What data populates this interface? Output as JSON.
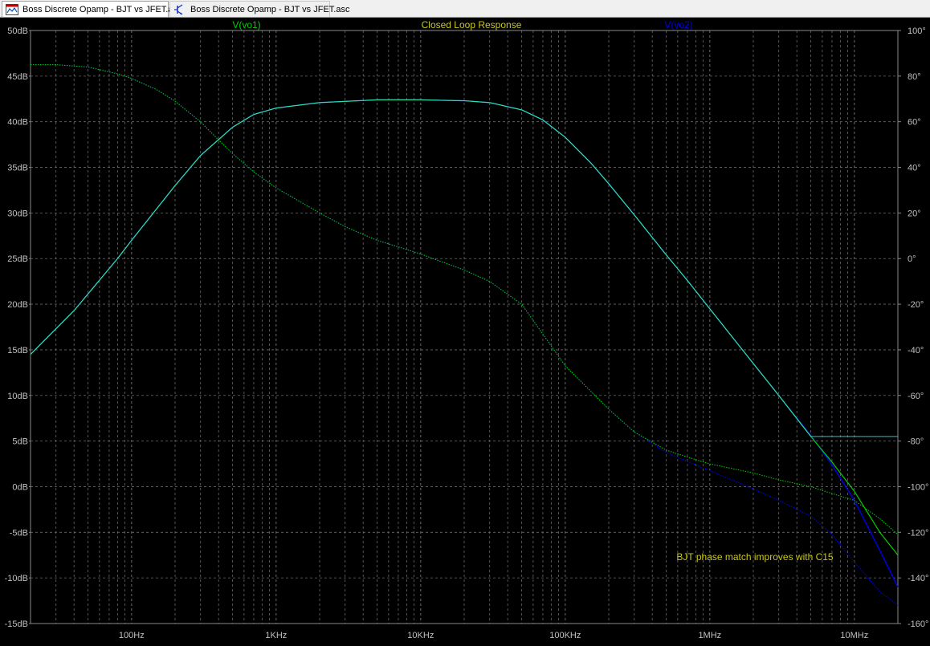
{
  "tabs": [
    {
      "label": "Boss Discrete Opamp - BJT vs JFET.asc",
      "icon": "waveform-window-icon",
      "active": true
    },
    {
      "label": "Boss Discrete Opamp - BJT vs JFET.asc",
      "icon": "schematic-transistor-icon",
      "active": false
    }
  ],
  "colors": {
    "background": "#000000",
    "grid": "#6a6a6a",
    "axis_text": "#c0c0c0",
    "title": "#c8c820",
    "vo1": "#00d000",
    "vo2": "#0000e0",
    "overlap": "#40e0e0",
    "annotation": "#c8c820"
  },
  "chart_data": {
    "type": "line",
    "title": "Closed Loop Response",
    "annotation": "BJT phase match improves with C15",
    "x_scale": "log",
    "xlim": [
      20,
      20000000
    ],
    "x_ticks": [
      {
        "value": 100,
        "label": "100Hz"
      },
      {
        "value": 1000,
        "label": "1KHz"
      },
      {
        "value": 10000,
        "label": "10KHz"
      },
      {
        "value": 100000,
        "label": "100KHz"
      },
      {
        "value": 1000000,
        "label": "1MHz"
      },
      {
        "value": 10000000,
        "label": "10MHz"
      }
    ],
    "y_left": {
      "unit": "dB",
      "lim": [
        -15,
        50
      ],
      "ticks": [
        "50dB",
        "45dB",
        "40dB",
        "35dB",
        "30dB",
        "25dB",
        "20dB",
        "15dB",
        "10dB",
        "5dB",
        "0dB",
        "-5dB",
        "-10dB",
        "-15dB"
      ]
    },
    "y_right": {
      "unit": "°",
      "lim": [
        -160,
        100
      ],
      "ticks": [
        "100°",
        "80°",
        "60°",
        "40°",
        "20°",
        "0°",
        "-20°",
        "-40°",
        "-60°",
        "-80°",
        "-100°",
        "-120°",
        "-140°",
        "-160°"
      ]
    },
    "grid": true,
    "series": [
      {
        "name": "V(vo1)",
        "magnitude_db": [
          [
            20,
            14.5
          ],
          [
            40,
            19.3
          ],
          [
            80,
            25
          ],
          [
            100,
            27
          ],
          [
            200,
            33
          ],
          [
            300,
            36.3
          ],
          [
            500,
            39.4
          ],
          [
            700,
            40.8
          ],
          [
            1000,
            41.5
          ],
          [
            2000,
            42.1
          ],
          [
            5000,
            42.4
          ],
          [
            10000,
            42.4
          ],
          [
            20000,
            42.3
          ],
          [
            30000,
            42.1
          ],
          [
            50000,
            41.3
          ],
          [
            70000,
            40.2
          ],
          [
            100000,
            38.3
          ],
          [
            150000,
            35.5
          ],
          [
            200000,
            33.2
          ],
          [
            300000,
            29.8
          ],
          [
            500000,
            25.4
          ],
          [
            700000,
            22.6
          ],
          [
            1000000,
            19.5
          ],
          [
            2000000,
            13.5
          ],
          [
            3000000,
            10
          ],
          [
            5000000,
            5.5
          ],
          [
            7000000,
            2.7
          ],
          [
            10000000,
            -0.5
          ],
          [
            15000000,
            -5
          ],
          [
            20000000,
            -7.5
          ]
        ],
        "phase_deg": [
          [
            20,
            85
          ],
          [
            30,
            85
          ],
          [
            50,
            84
          ],
          [
            80,
            81
          ],
          [
            100,
            79
          ],
          [
            150,
            74
          ],
          [
            200,
            69
          ],
          [
            300,
            60
          ],
          [
            400,
            52
          ],
          [
            500,
            46
          ],
          [
            700,
            38
          ],
          [
            1000,
            31
          ],
          [
            2000,
            20
          ],
          [
            3000,
            14
          ],
          [
            5000,
            8
          ],
          [
            8000,
            4
          ],
          [
            10000,
            2
          ],
          [
            20000,
            -5
          ],
          [
            30000,
            -10
          ],
          [
            50000,
            -20
          ],
          [
            100000,
            -47
          ],
          [
            200000,
            -66
          ],
          [
            300000,
            -76
          ],
          [
            500000,
            -84
          ],
          [
            700000,
            -87
          ],
          [
            1000000,
            -90
          ],
          [
            2000000,
            -94
          ],
          [
            3000000,
            -97
          ],
          [
            5000000,
            -100
          ],
          [
            7000000,
            -103
          ],
          [
            10000000,
            -106
          ],
          [
            15000000,
            -114
          ],
          [
            20000000,
            -121
          ]
        ]
      },
      {
        "name": "V(vo2)",
        "magnitude_db": [
          [
            20,
            14.5
          ],
          [
            40,
            19.3
          ],
          [
            80,
            25
          ],
          [
            100,
            27
          ],
          [
            200,
            33
          ],
          [
            300,
            36.3
          ],
          [
            500,
            39.4
          ],
          [
            700,
            40.8
          ],
          [
            1000,
            41.5
          ],
          [
            2000,
            42.1
          ],
          [
            5000,
            42.4
          ],
          [
            10000,
            42.4
          ],
          [
            20000,
            42.3
          ],
          [
            30000,
            42.1
          ],
          [
            50000,
            41.3
          ],
          [
            70000,
            40.2
          ],
          [
            100000,
            38.3
          ],
          [
            150000,
            35.5
          ],
          [
            200000,
            33.2
          ],
          [
            300000,
            29.8
          ],
          [
            500000,
            25.4
          ],
          [
            700000,
            22.6
          ],
          [
            1000000,
            19.5
          ],
          [
            2000000,
            13.5
          ],
          [
            3000000,
            10
          ],
          [
            5000000,
            5.6
          ],
          [
            7000000,
            2.4
          ],
          [
            10000000,
            -1.5
          ],
          [
            15000000,
            -7
          ],
          [
            20000000,
            -11
          ]
        ],
        "phase_deg": [
          [
            20,
            85
          ],
          [
            30,
            85
          ],
          [
            50,
            84
          ],
          [
            80,
            81
          ],
          [
            100,
            79
          ],
          [
            150,
            74
          ],
          [
            200,
            69
          ],
          [
            300,
            60
          ],
          [
            400,
            52
          ],
          [
            500,
            46
          ],
          [
            700,
            38
          ],
          [
            1000,
            31
          ],
          [
            2000,
            20
          ],
          [
            3000,
            14
          ],
          [
            5000,
            8
          ],
          [
            8000,
            4
          ],
          [
            10000,
            2
          ],
          [
            20000,
            -5
          ],
          [
            30000,
            -10
          ],
          [
            50000,
            -20
          ],
          [
            100000,
            -47
          ],
          [
            200000,
            -66
          ],
          [
            300000,
            -76
          ],
          [
            500000,
            -85
          ],
          [
            700000,
            -89
          ],
          [
            1000000,
            -93
          ],
          [
            2000000,
            -101
          ],
          [
            3000000,
            -106
          ],
          [
            5000000,
            -113
          ],
          [
            7000000,
            -121
          ],
          [
            10000000,
            -133
          ],
          [
            15000000,
            -146
          ],
          [
            20000000,
            -152
          ]
        ]
      }
    ]
  }
}
